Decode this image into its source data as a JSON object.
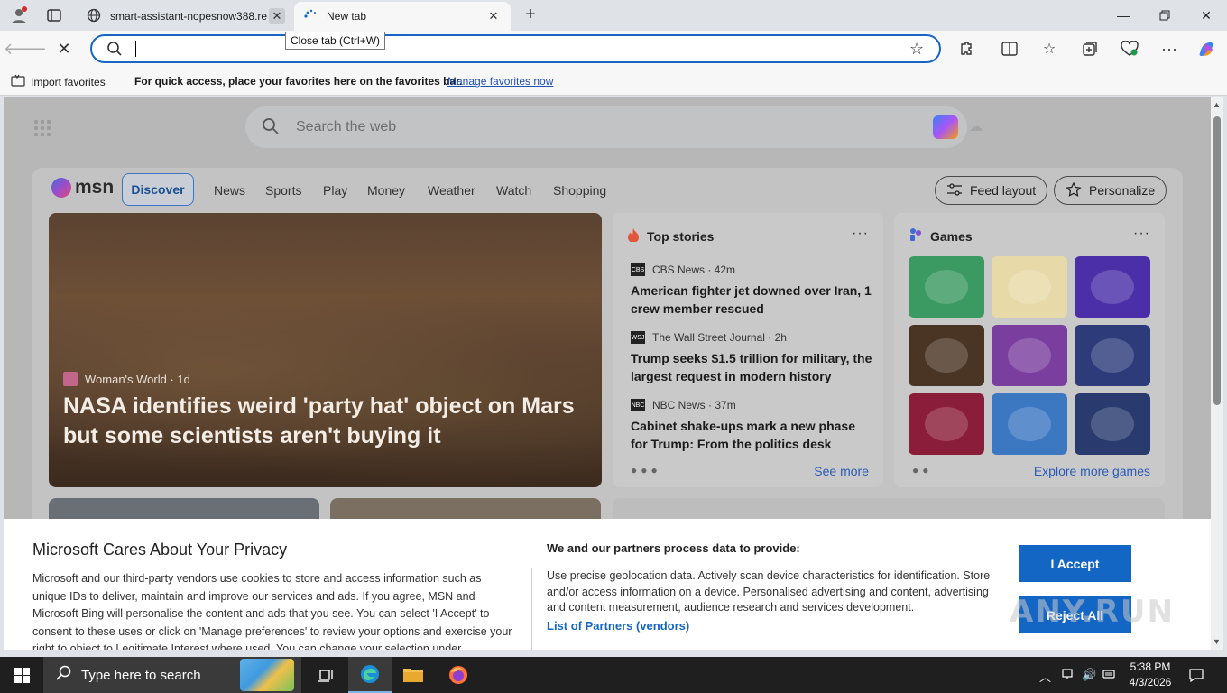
{
  "browser": {
    "tabs": [
      {
        "title": "smart-assistant-nopesnow388.re",
        "active": false
      },
      {
        "title": "New tab",
        "active": true
      }
    ],
    "tooltip": "Close tab (Ctrl+W)",
    "address_value": "",
    "favorites_bar": {
      "import_label": "Import favorites",
      "message": "For quick access, place your favorites here on the favorites bar.",
      "manage_link": "Manage favorites now"
    }
  },
  "newtab": {
    "search_placeholder": "Search the web",
    "msn": {
      "logo_text": "msn",
      "nav": [
        "Discover",
        "News",
        "Sports",
        "Play",
        "Money",
        "Weather",
        "Watch",
        "Shopping"
      ],
      "feed_layout_label": "Feed layout",
      "personalize_label": "Personalize"
    },
    "hero": {
      "source": "Woman's World · 1d",
      "headline": "NASA identifies weird 'party hat' object on Mars but some scientists aren't buying it"
    },
    "top_stories": {
      "title": "Top stories",
      "more": "···",
      "items": [
        {
          "source": "CBS News · 42m",
          "logo": "CBS",
          "title": "American fighter jet downed over Iran, 1 crew member rescued"
        },
        {
          "source": "The Wall Street Journal · 2h",
          "logo": "WSJ",
          "title": "Trump seeks $1.5 trillion for military, the largest request in modern history"
        },
        {
          "source": "NBC News · 37m",
          "logo": "NBC",
          "title": "Cabinet shake-ups mark a new phase for Trump: From the politics desk"
        }
      ],
      "see_more": "See more"
    },
    "games": {
      "title": "Games",
      "more": "···",
      "tile_colors": [
        "#3b9a62",
        "#e8d9a8",
        "#4b2fa8",
        "#4a3524",
        "#7a3f9e",
        "#2e3b7a",
        "#8a1e3a",
        "#3c78c2",
        "#283a6e"
      ],
      "explore_label": "Explore more games"
    }
  },
  "privacy": {
    "title": "Microsoft Cares About Your Privacy",
    "body": "Microsoft and our third-party vendors use cookies to store and access information such as unique IDs to deliver, maintain and improve our services and ads. If you agree, MSN and Microsoft Bing will personalise the content and ads that you see. You can select 'I Accept' to consent to these uses or click on 'Manage preferences' to review your options and exercise your right to object to Legitimate Interest where used. You can change your selection under",
    "data_title": "We and our partners process data to provide:",
    "data_body": "Use precise geolocation data. Actively scan device characteristics for identification. Store and/or access information on a device. Personalised advertising and content, advertising and content measurement, audience research and services development.",
    "partners_link": "List of Partners (vendors)",
    "accept_label": "I Accept",
    "reject_label": "Reject All",
    "watermark": "ANY.RUN"
  },
  "taskbar": {
    "search_placeholder": "Type here to search",
    "time": "5:38 PM",
    "date": "4/3/2026"
  },
  "colors": {
    "accent": "#1466c5",
    "link": "#1f4fb4",
    "taskbar": "#1f1f1f"
  }
}
